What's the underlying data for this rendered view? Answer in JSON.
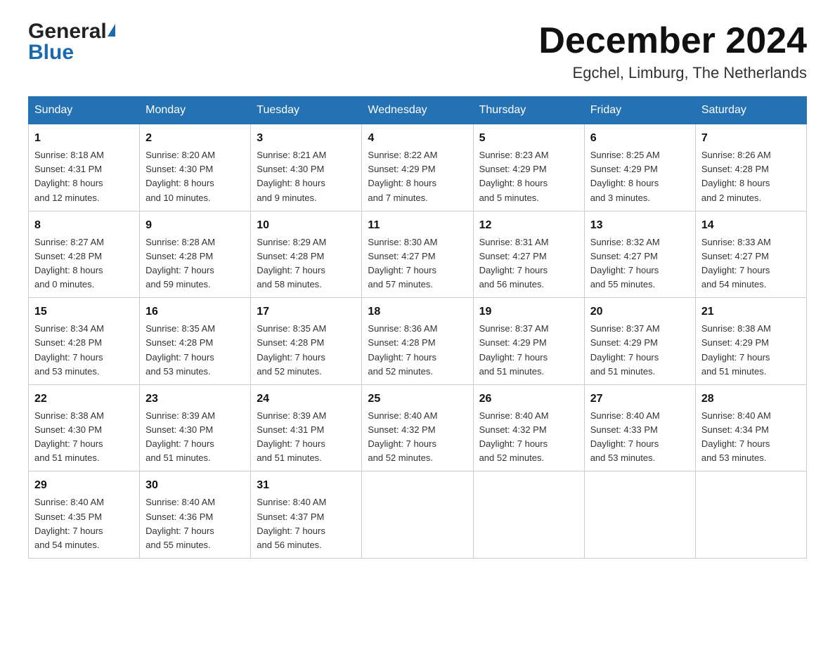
{
  "header": {
    "logo_general": "General",
    "logo_blue": "Blue",
    "month_title": "December 2024",
    "location": "Egchel, Limburg, The Netherlands"
  },
  "days_of_week": [
    "Sunday",
    "Monday",
    "Tuesday",
    "Wednesday",
    "Thursday",
    "Friday",
    "Saturday"
  ],
  "weeks": [
    [
      {
        "day": "1",
        "info": "Sunrise: 8:18 AM\nSunset: 4:31 PM\nDaylight: 8 hours\nand 12 minutes."
      },
      {
        "day": "2",
        "info": "Sunrise: 8:20 AM\nSunset: 4:30 PM\nDaylight: 8 hours\nand 10 minutes."
      },
      {
        "day": "3",
        "info": "Sunrise: 8:21 AM\nSunset: 4:30 PM\nDaylight: 8 hours\nand 9 minutes."
      },
      {
        "day": "4",
        "info": "Sunrise: 8:22 AM\nSunset: 4:29 PM\nDaylight: 8 hours\nand 7 minutes."
      },
      {
        "day": "5",
        "info": "Sunrise: 8:23 AM\nSunset: 4:29 PM\nDaylight: 8 hours\nand 5 minutes."
      },
      {
        "day": "6",
        "info": "Sunrise: 8:25 AM\nSunset: 4:29 PM\nDaylight: 8 hours\nand 3 minutes."
      },
      {
        "day": "7",
        "info": "Sunrise: 8:26 AM\nSunset: 4:28 PM\nDaylight: 8 hours\nand 2 minutes."
      }
    ],
    [
      {
        "day": "8",
        "info": "Sunrise: 8:27 AM\nSunset: 4:28 PM\nDaylight: 8 hours\nand 0 minutes."
      },
      {
        "day": "9",
        "info": "Sunrise: 8:28 AM\nSunset: 4:28 PM\nDaylight: 7 hours\nand 59 minutes."
      },
      {
        "day": "10",
        "info": "Sunrise: 8:29 AM\nSunset: 4:28 PM\nDaylight: 7 hours\nand 58 minutes."
      },
      {
        "day": "11",
        "info": "Sunrise: 8:30 AM\nSunset: 4:27 PM\nDaylight: 7 hours\nand 57 minutes."
      },
      {
        "day": "12",
        "info": "Sunrise: 8:31 AM\nSunset: 4:27 PM\nDaylight: 7 hours\nand 56 minutes."
      },
      {
        "day": "13",
        "info": "Sunrise: 8:32 AM\nSunset: 4:27 PM\nDaylight: 7 hours\nand 55 minutes."
      },
      {
        "day": "14",
        "info": "Sunrise: 8:33 AM\nSunset: 4:27 PM\nDaylight: 7 hours\nand 54 minutes."
      }
    ],
    [
      {
        "day": "15",
        "info": "Sunrise: 8:34 AM\nSunset: 4:28 PM\nDaylight: 7 hours\nand 53 minutes."
      },
      {
        "day": "16",
        "info": "Sunrise: 8:35 AM\nSunset: 4:28 PM\nDaylight: 7 hours\nand 53 minutes."
      },
      {
        "day": "17",
        "info": "Sunrise: 8:35 AM\nSunset: 4:28 PM\nDaylight: 7 hours\nand 52 minutes."
      },
      {
        "day": "18",
        "info": "Sunrise: 8:36 AM\nSunset: 4:28 PM\nDaylight: 7 hours\nand 52 minutes."
      },
      {
        "day": "19",
        "info": "Sunrise: 8:37 AM\nSunset: 4:29 PM\nDaylight: 7 hours\nand 51 minutes."
      },
      {
        "day": "20",
        "info": "Sunrise: 8:37 AM\nSunset: 4:29 PM\nDaylight: 7 hours\nand 51 minutes."
      },
      {
        "day": "21",
        "info": "Sunrise: 8:38 AM\nSunset: 4:29 PM\nDaylight: 7 hours\nand 51 minutes."
      }
    ],
    [
      {
        "day": "22",
        "info": "Sunrise: 8:38 AM\nSunset: 4:30 PM\nDaylight: 7 hours\nand 51 minutes."
      },
      {
        "day": "23",
        "info": "Sunrise: 8:39 AM\nSunset: 4:30 PM\nDaylight: 7 hours\nand 51 minutes."
      },
      {
        "day": "24",
        "info": "Sunrise: 8:39 AM\nSunset: 4:31 PM\nDaylight: 7 hours\nand 51 minutes."
      },
      {
        "day": "25",
        "info": "Sunrise: 8:40 AM\nSunset: 4:32 PM\nDaylight: 7 hours\nand 52 minutes."
      },
      {
        "day": "26",
        "info": "Sunrise: 8:40 AM\nSunset: 4:32 PM\nDaylight: 7 hours\nand 52 minutes."
      },
      {
        "day": "27",
        "info": "Sunrise: 8:40 AM\nSunset: 4:33 PM\nDaylight: 7 hours\nand 53 minutes."
      },
      {
        "day": "28",
        "info": "Sunrise: 8:40 AM\nSunset: 4:34 PM\nDaylight: 7 hours\nand 53 minutes."
      }
    ],
    [
      {
        "day": "29",
        "info": "Sunrise: 8:40 AM\nSunset: 4:35 PM\nDaylight: 7 hours\nand 54 minutes."
      },
      {
        "day": "30",
        "info": "Sunrise: 8:40 AM\nSunset: 4:36 PM\nDaylight: 7 hours\nand 55 minutes."
      },
      {
        "day": "31",
        "info": "Sunrise: 8:40 AM\nSunset: 4:37 PM\nDaylight: 7 hours\nand 56 minutes."
      },
      {
        "day": "",
        "info": ""
      },
      {
        "day": "",
        "info": ""
      },
      {
        "day": "",
        "info": ""
      },
      {
        "day": "",
        "info": ""
      }
    ]
  ]
}
